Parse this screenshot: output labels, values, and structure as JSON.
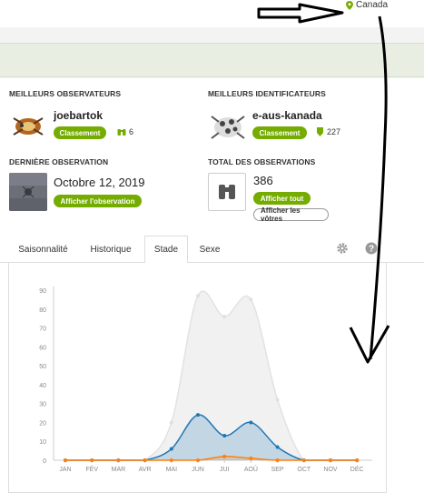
{
  "location": {
    "label": "Canada"
  },
  "stats": {
    "top_observers": {
      "title": "MEILLEURS OBSERVATEURS",
      "user": "joebartok",
      "button": "Classement",
      "count": "6"
    },
    "top_identifiers": {
      "title": "MEILLEURS IDENTIFICATEURS",
      "user": "e-aus-kanada",
      "button": "Classement",
      "count": "227"
    },
    "last_observation": {
      "title": "DERNIÈRE OBSERVATION",
      "date": "Octobre 12, 2019",
      "button": "Afficher l'observation"
    },
    "total_observations": {
      "title": "TOTAL DES OBSERVATIONS",
      "count": "386",
      "button_all": "Afficher tout",
      "button_yours": "Afficher les vôtres"
    }
  },
  "tabs": [
    {
      "label": "Saisonnalité"
    },
    {
      "label": "Historique"
    },
    {
      "label": "Stade"
    },
    {
      "label": "Sexe"
    }
  ],
  "active_tab": "Stade",
  "colors": {
    "brand": "#74ac00",
    "blue": "#1f77b4",
    "orange": "#ff7f0e",
    "gray": "#cccccc"
  },
  "chart_data": {
    "type": "area",
    "categories": [
      "JAN",
      "FÉV",
      "MAR",
      "AVR",
      "MAI",
      "JUN",
      "JUI",
      "AOÛ",
      "SEP",
      "OCT",
      "NOV",
      "DÉC"
    ],
    "series": [
      {
        "values": [
          0,
          0,
          0,
          0,
          20,
          87,
          76,
          85,
          32,
          0,
          0,
          0
        ],
        "color": "#cccccc"
      },
      {
        "values": [
          0,
          0,
          0,
          0,
          6,
          24,
          13,
          20,
          7,
          0,
          0,
          0
        ],
        "color": "#1f77b4"
      },
      {
        "values": [
          0,
          0,
          0,
          0,
          0,
          0,
          2,
          1,
          0,
          0,
          0,
          0
        ],
        "color": "#ff7f0e"
      }
    ],
    "yticks": [
      0,
      10,
      20,
      30,
      40,
      50,
      60,
      70,
      80,
      90
    ],
    "ylim": [
      0,
      90
    ],
    "grid": false
  }
}
